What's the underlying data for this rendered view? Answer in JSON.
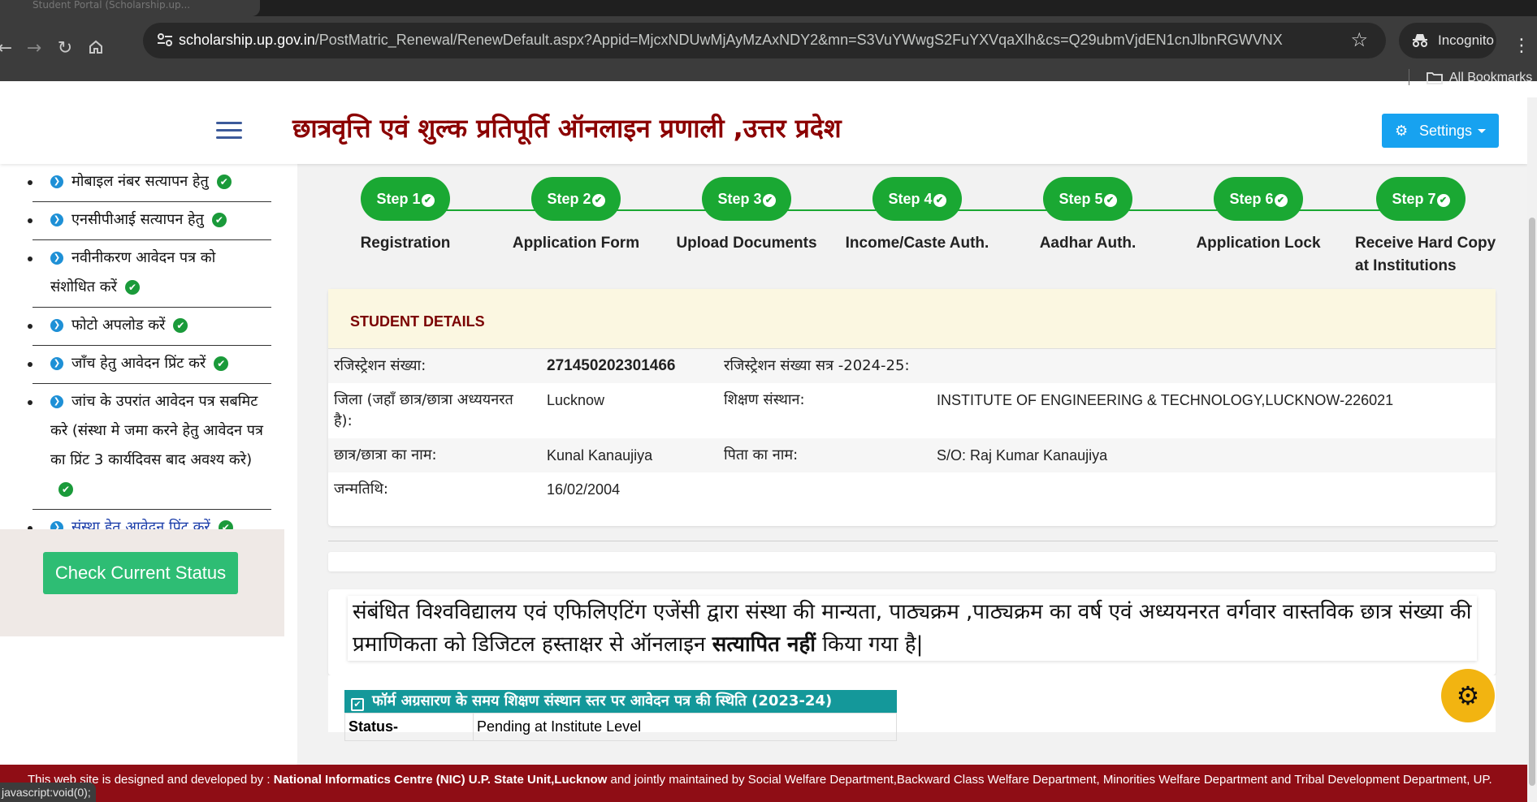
{
  "browser": {
    "tab_title": "Student Portal (Scholarship.up...",
    "url_host": "scholarship.up.gov.in",
    "url_path": "/PostMatric_Renewal/RenewDefault.aspx?Appid=MjcxNDUwMjAyMzAxNDY2&mn=S3VuYWwgS2FuYXVqaXlh&cs=Q29ubmVjdEN1cnJlbnRGWVNX",
    "incognito_label": "Incognito",
    "bookmarks_label": "All Bookmarks",
    "status_text": "javascript:void(0);",
    "icons": [
      "back-icon",
      "forward-icon",
      "reload-icon",
      "home-icon",
      "site-info-icon",
      "star-icon",
      "incognito-icon",
      "menu-icon",
      "folder-icon"
    ]
  },
  "header": {
    "title": "छात्रवृत्ति एवं शुल्क प्रतिपूर्ति ऑनलाइन प्रणाली ,उत्तर प्रदेश",
    "settings_label": "Settings"
  },
  "sidebar": {
    "items": [
      {
        "label": "मोबाइल नंबर सत्यापन हेतु",
        "done": true
      },
      {
        "label": "एनसीपीआई सत्यापन हेतु",
        "done": true
      },
      {
        "label": "नवीनीकरण आवेदन पत्र को संशोधित करें",
        "done": true
      },
      {
        "label": "फोटो अपलोड करें",
        "done": true
      },
      {
        "label": "जाँच हेतु आवेदन प्रिंट करें",
        "done": true
      },
      {
        "label": "जांच के उपरांत आवेदन पत्र सबमिट करे (संस्था मे जमा करने हेतु आवेदन पत्र का प्रिंट 3 कार्यदिवस बाद अवश्य करे)",
        "done": true
      },
      {
        "label": "संस्था हेतु आवेदन प्रिंट करें",
        "done": true
      }
    ],
    "check_status_label": "Check Current Status"
  },
  "steps": [
    {
      "pill": "Step 1",
      "label": "Registration"
    },
    {
      "pill": "Step 2",
      "label": "Application Form"
    },
    {
      "pill": "Step 3",
      "label": "Upload Documents"
    },
    {
      "pill": "Step 4",
      "label": "Income/Caste Auth."
    },
    {
      "pill": "Step 5",
      "label": "Aadhar Auth."
    },
    {
      "pill": "Step 6",
      "label": "Application Lock"
    },
    {
      "pill": "Step 7",
      "label": "Receive Hard Copy at Institutions"
    }
  ],
  "student_details": {
    "heading": "STUDENT DETAILS",
    "reg_no_label": "रजिस्ट्रेशन संख्या:",
    "reg_no": "271450202301466",
    "reg_session_label": "रजिस्ट्रेशन संख्या सत्र -2024-25:",
    "district_label": "जिला (जहाँ छात्र/छात्रा अध्ययनरत है):",
    "district": "Lucknow",
    "institute_label": "शिक्षण संस्थान:",
    "institute": "INSTITUTE OF ENGINEERING & TECHNOLOGY,LUCKNOW-226021",
    "student_name_label": "छात्र/छात्रा का नाम:",
    "student_name": "Kunal Kanaujiya",
    "father_name_label": "पिता का नाम:",
    "father_name": "S/O: Raj Kumar Kanaujiya",
    "dob_label": "जन्मतिथि:",
    "dob": "16/02/2004"
  },
  "notice": {
    "text_before": "संबंधित विश्वविद्यालय एवं एफिलिएटिंग एजेंसी द्वारा संस्था की मान्यता, पाठ्यक्रम ,पाठ्यक्रम का वर्ष एवं अध्ययनरत वर्गवार वास्तविक छात्र संख्या की प्रमाणिकता को डिजिटल हस्ताक्षर से ऑनलाइन",
    "text_bold": "सत्यापित नहीं",
    "text_after": "किया गया है|"
  },
  "form_status": {
    "heading": "फॉर्म अग्रसारण के समय शिक्षण संस्थान स्तर पर आवेदन पत्र की स्थिति (2023-24)",
    "status_label": "Status-",
    "status_value": "Pending at Institute Level"
  },
  "footer": {
    "prefix": "This web site is designed and developed by :",
    "org": "National Informatics Centre (NIC) U.P. State Unit,Lucknow",
    "suffix": "and jointly maintained by Social Welfare Department,Backward Class Welfare Department, Minorities Welfare Department and Tribal Development Department, UP."
  },
  "colors": {
    "title": "#8b0000",
    "step_green": "#1aa833",
    "settings_blue": "#17a2f0",
    "status_btn": "#2ebd74",
    "footer": "#8f0d15",
    "teal_head": "#14989a"
  }
}
